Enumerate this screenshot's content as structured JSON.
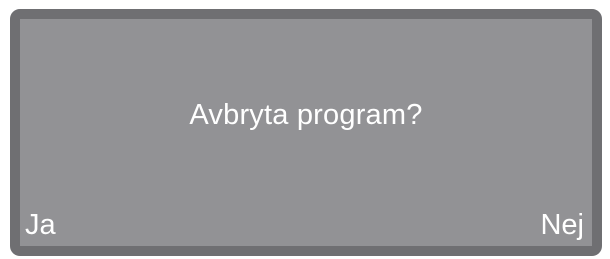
{
  "dialog": {
    "message": "Avbryta program?",
    "left_option": "Ja",
    "right_option": "Nej"
  },
  "colors": {
    "screen_background": "#929295",
    "screen_border": "#6f6f72",
    "text": "#ffffff"
  }
}
